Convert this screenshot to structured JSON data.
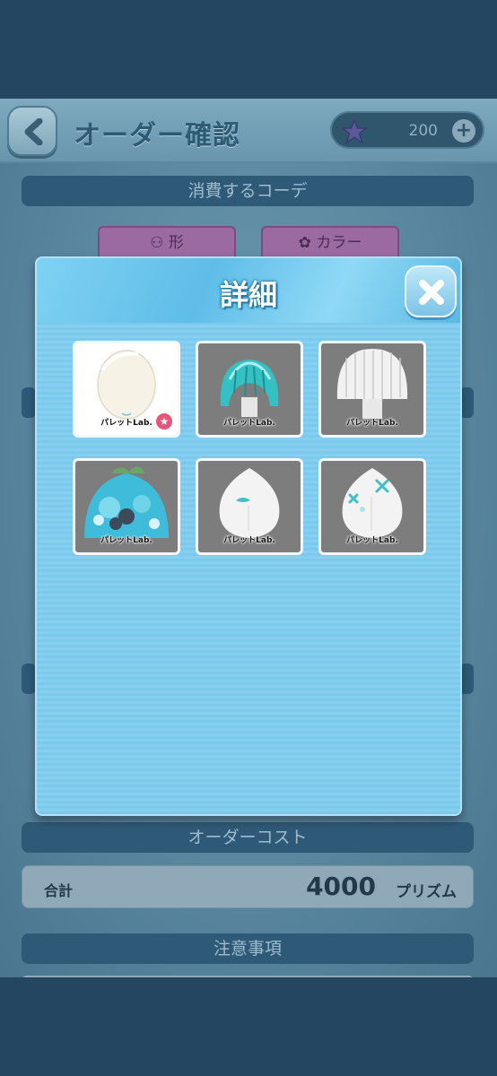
{
  "header": {
    "title": "オーダー確認",
    "currency_value": "200"
  },
  "sections": {
    "consume_code": "消費するコーデ",
    "order_cost": "オーダーコスト",
    "notes": "注意事項"
  },
  "tabs": [
    {
      "label": "形",
      "icon": "shape-icon"
    },
    {
      "label": "カラー",
      "icon": "palette-icon"
    }
  ],
  "total": {
    "label": "合計",
    "amount": "4000",
    "unit": "プリズム"
  },
  "modal": {
    "title": "詳細",
    "items": [
      {
        "brand": "パレットLab.",
        "name": "egg-hair-base",
        "selected": true
      },
      {
        "brand": "パレットLab.",
        "name": "teal-bob-hair"
      },
      {
        "brand": "パレットLab.",
        "name": "white-straight-hair"
      },
      {
        "brand": "パレットLab.",
        "name": "teal-floral-head"
      },
      {
        "brand": "パレットLab.",
        "name": "white-head-eye"
      },
      {
        "brand": "パレットLab.",
        "name": "white-head-x-marks"
      }
    ]
  },
  "colors": {
    "accent": "#7cc9ee",
    "badge": "#e8557a",
    "teal": "#3fc7c9"
  }
}
